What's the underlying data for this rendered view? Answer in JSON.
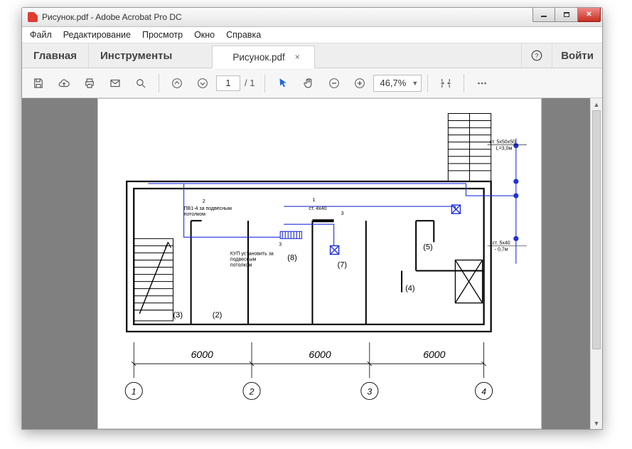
{
  "window": {
    "title": "Рисунок.pdf - Adobe Acrobat Pro DC"
  },
  "menu": {
    "file": "Файл",
    "edit": "Редактирование",
    "view": "Просмотр",
    "window": "Окно",
    "help": "Справка"
  },
  "tabs": {
    "home": "Главная",
    "tools": "Инструменты",
    "document": "Рисунок.pdf",
    "close_glyph": "×"
  },
  "header": {
    "signin": "Войти"
  },
  "toolbar": {
    "page_current": "1",
    "page_total": "/ 1",
    "zoom_value": "46,7%"
  },
  "icons": {
    "save": "save-icon",
    "cloud": "cloud-upload-icon",
    "print": "print-icon",
    "mail": "mail-icon",
    "search": "search-icon",
    "prev_page": "arrow-up-icon",
    "next_page": "arrow-down-icon",
    "cursor": "cursor-icon",
    "hand": "hand-icon",
    "zoom_out": "zoom-out-icon",
    "zoom_in": "zoom-in-icon",
    "fit": "fit-width-icon",
    "more": "more-icon",
    "help": "help-icon"
  },
  "drawing": {
    "dimensions": {
      "d1": "6000",
      "d2": "6000",
      "d3": "6000"
    },
    "grid_labels": {
      "g1": "1",
      "g2": "2",
      "g3": "3",
      "g4": "4"
    },
    "room_labels": [
      "(2)",
      "(3)",
      "(4)",
      "(5)",
      "(7)",
      "(8)"
    ],
    "note1_line1": "ПВ1-4 за подвесным",
    "note1_line2": "потолком",
    "note2_line1": "КУП установить за",
    "note2_line2": "подвесным",
    "note2_line3": "потолком",
    "callout_center": "ст. 4х40",
    "side_top_1": "ст. 5х50х50",
    "side_top_2": "L=3,0м",
    "side_bot_1": "ст. 5х40",
    "side_bot_2": "- 0,7м",
    "small1": "1",
    "small2": "2",
    "small3": "3"
  }
}
